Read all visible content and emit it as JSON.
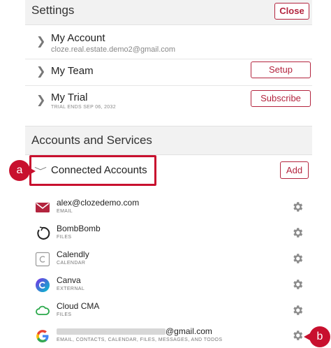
{
  "settings": {
    "title": "Settings",
    "close_label": "Close"
  },
  "rows": {
    "my_account": {
      "title": "My Account",
      "email": "cloze.real.estate.demo2@gmail.com"
    },
    "my_team": {
      "title": "My Team",
      "button": "Setup"
    },
    "my_trial": {
      "title": "My Trial",
      "subtitle": "TRIAL ENDS SEP 06, 2032",
      "button": "Subscribe"
    }
  },
  "accounts_section": {
    "title": "Accounts and Services",
    "connected_label": "Connected Accounts",
    "add_label": "Add"
  },
  "callouts": {
    "a": "a",
    "b": "b"
  },
  "accounts": [
    {
      "name": "alex@clozedemo.com",
      "type": "EMAIL",
      "icon": "email-icon"
    },
    {
      "name": "BombBomb",
      "type": "FILES",
      "icon": "bombbomb-icon"
    },
    {
      "name": "Calendly",
      "type": "CALENDAR",
      "icon": "calendly-icon"
    },
    {
      "name": "Canva",
      "type": "EXTERNAL",
      "icon": "canva-icon"
    },
    {
      "name": "Cloud CMA",
      "type": "FILES",
      "icon": "cloudcma-icon"
    },
    {
      "name": "@gmail.com",
      "type": "EMAIL, CONTACTS, CALENDAR, FILES, MESSAGES, AND TODOS",
      "icon": "google-icon"
    }
  ],
  "colors": {
    "accent": "#b3243e",
    "callout": "#c8102e",
    "header_bg": "#f2f2f2"
  }
}
